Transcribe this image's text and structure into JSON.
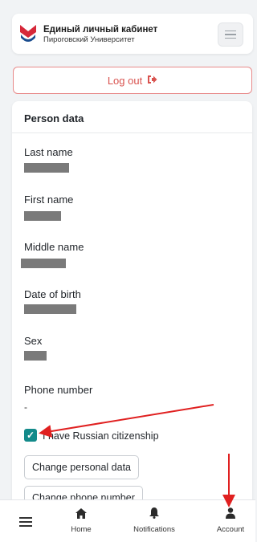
{
  "header": {
    "brand_title": "Единый личный кабинет",
    "brand_subtitle": "Пироговский Университет",
    "menu_icon": "hamburger-icon"
  },
  "logout": {
    "label": "Log out",
    "icon": "sign-out-icon",
    "color": "#d9534f"
  },
  "person_card": {
    "title": "Person data",
    "fields": [
      {
        "label": "Last name",
        "value": ""
      },
      {
        "label": "First name",
        "value": ""
      },
      {
        "label": "Middle name",
        "value": ""
      },
      {
        "label": "Date of birth",
        "value": ""
      },
      {
        "label": "Sex",
        "value": ""
      },
      {
        "label": "Phone number",
        "value": "-"
      }
    ],
    "citizenship_checkbox": {
      "label": "I have Russian citizenship",
      "checked": true,
      "color": "#138a8a"
    },
    "buttons": {
      "change_personal": "Change personal data",
      "change_phone": "Change phone number"
    }
  },
  "tabbar": {
    "menu_icon": "hamburger-icon",
    "tabs": [
      {
        "label": "Home",
        "icon": "home-icon"
      },
      {
        "label": "Notifications",
        "icon": "bell-icon"
      },
      {
        "label": "Account",
        "icon": "user-icon"
      }
    ]
  },
  "annotation_color": "#e02020"
}
